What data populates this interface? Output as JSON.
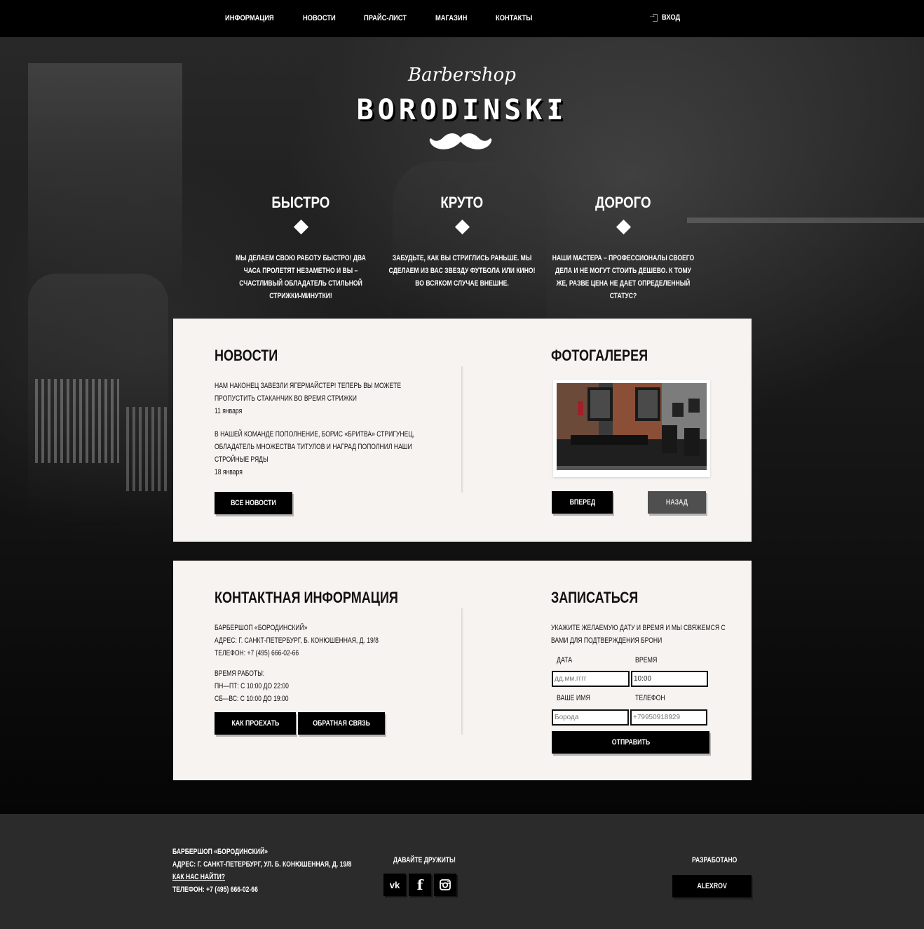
{
  "nav": {
    "items": [
      "ИНФОРМАЦИЯ",
      "НОВОСТИ",
      "ПРАЙС-ЛИСТ",
      "МАГАЗИН",
      "КОНТАКТЫ"
    ],
    "login": "ВХОД"
  },
  "logo": {
    "script": "Barbershop",
    "main": "BORODINSKI"
  },
  "features": [
    {
      "title": "БЫСТРО",
      "text": "МЫ ДЕЛАЕМ СВОЮ РАБОТУ БЫСТРО! ДВА ЧАСА ПРОЛЕТЯТ НЕЗАМЕТНО И ВЫ – СЧАСТЛИВЫЙ ОБЛАДАТЕЛЬ СТИЛЬНОЙ СТРИЖКИ-МИНУТКИ!"
    },
    {
      "title": "КРУТО",
      "text": "ЗАБУДЬТЕ, КАК ВЫ СТРИГЛИСЬ РАНЬШЕ. МЫ СДЕЛАЕМ ИЗ ВАС ЗВЕЗДУ ФУТБОЛА ИЛИ КИНО! ВО ВСЯКОМ СЛУЧАЕ ВНЕШНЕ."
    },
    {
      "title": "ДОРОГО",
      "text": "НАШИ МАСТЕРА – ПРОФЕССИОНАЛЫ СВОЕГО ДЕЛА И НЕ МОГУТ СТОИТЬ ДЕШЕВО. К ТОМУ ЖЕ, РАЗВЕ ЦЕНА НЕ ДАЕТ ОПРЕДЕЛЕННЫЙ СТАТУС?"
    }
  ],
  "news": {
    "title": "НОВОСТИ",
    "items": [
      {
        "line1": "НАМ НАКОНЕЦ ЗАВЕЗЛИ ЯГЕРМАЙСТЕР! ТЕПЕРЬ ВЫ МОЖЕТЕ",
        "line2": "ПРОПУСТИТЬ СТАКАНЧИК ВО ВРЕМЯ СТРИЖКИ",
        "line3": "",
        "date": "11 января"
      },
      {
        "line1": "В НАШЕЙ КОМАНДЕ ПОПОЛНЕНИЕ, БОРИС «БРИТВА» СТРИГУНЕЦ,",
        "line2": "ОБЛАДАТЕЛЬ МНОЖЕСТВА ТИТУЛОВ И НАГРАД ПОПОЛНИЛ НАШИ",
        "line3": "СТРОЙНЫЕ РЯДЫ",
        "date": "18 января"
      }
    ],
    "all_button": "ВСЕ НОВОСТИ"
  },
  "gallery": {
    "title": "ФОТОГАЛЕРЕЯ",
    "next_button": "ВПЕРЕД",
    "prev_button": "НАЗАД"
  },
  "contacts": {
    "title": "КОНТАКТНАЯ ИНФОРМАЦИЯ",
    "name": "БАРБЕРШОП «БОРОДИНСКИЙ»",
    "address": "АДРЕС: Г. САНКТ-ПЕТЕРБУРГ, Б. КОНЮШЕННАЯ, Д. 19/8",
    "phone": "ТЕЛЕФОН: +7 (495) 666-02-66",
    "hours_title": "ВРЕМЯ РАБОТЫ:",
    "hours_weekday": "ПН—ПТ: С 10:00 ДО 22:00",
    "hours_weekend": "СБ—ВС: С 10:00 ДО 19:00",
    "route_button": "КАК ПРОЕХАТЬ",
    "feedback_button": "ОБРАТНАЯ СВЯЗЬ"
  },
  "booking": {
    "title": "ЗАПИСАТЬСЯ",
    "desc_line1": "УКАЖИТЕ ЖЕЛАЕМУЮ ДАТУ И ВРЕМЯ И МЫ СВЯЖЕМСЯ С",
    "desc_line2": "ВАМИ ДЛЯ ПОДТВЕРЖДЕНИЯ БРОНИ",
    "date_label": "ДАТА",
    "time_label": "ВРЕМЯ",
    "name_label": "ВАШЕ ИМЯ",
    "phone_label": "ТЕЛЕФОН",
    "date_placeholder": "дд.мм.гггг",
    "time_value": "10:00",
    "name_placeholder": "Борода",
    "phone_placeholder": "+79950918929",
    "submit_button": "ОТПРАВИТЬ"
  },
  "footer": {
    "name": "БАРБЕРШОП «БОРОДИНСКИЙ»",
    "address": "АДРЕС: Г. САНКТ-ПЕТЕРБУРГ, УЛ. Б. КОНЮШЕННАЯ, Д. 19/8",
    "find_link": "КАК НАС НАЙТИ?",
    "phone": "ТЕЛЕФОН: +7 (495) 666-02-66",
    "social_title": "ДАВАЙТЕ ДРУЖИТЬ!",
    "social": {
      "vk": "vk",
      "fb": "f",
      "ig": "instagram-icon"
    },
    "dev_title": "РАЗРАБОТАНО",
    "dev_button": "ALEXROV"
  }
}
